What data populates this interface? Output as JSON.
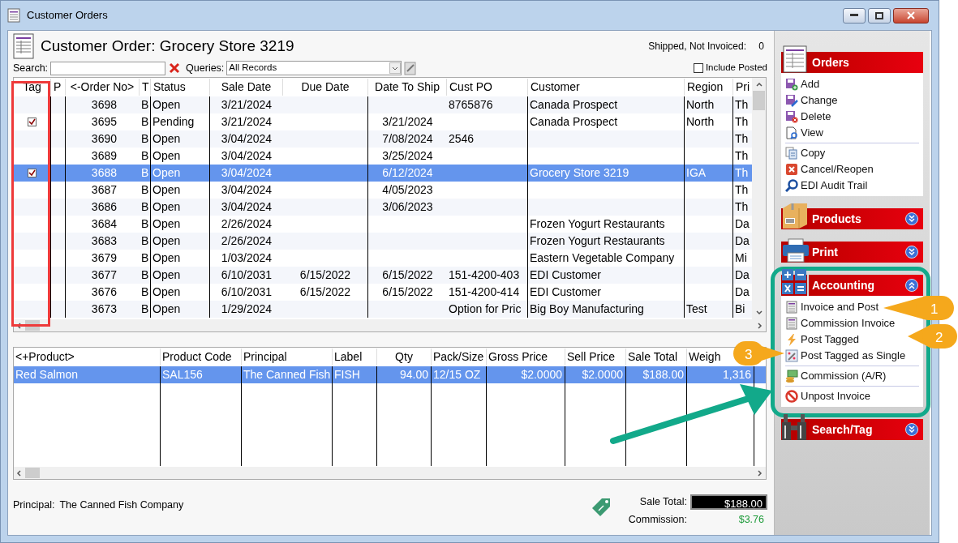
{
  "window": {
    "title": "Customer Orders"
  },
  "header": {
    "title": "Customer Order: Grocery Store 3219",
    "shipped_label": "Shipped, Not Invoiced:",
    "shipped_value": "0"
  },
  "search": {
    "label": "Search:",
    "queries_label": "Queries:",
    "query": "All Records",
    "include_posted": {
      "label": "Include Posted",
      "checked": false
    }
  },
  "orders": {
    "columns": [
      "Tag",
      "P",
      "<-Order No>",
      "T",
      "Status",
      "Sale Date",
      "Due Date",
      "Date To Ship",
      "Cust PO",
      "Customer",
      "Region",
      "Pri"
    ],
    "rows": [
      {
        "tagged": false,
        "selected": false,
        "cells": [
          "",
          "",
          "3698",
          "B",
          "Open",
          "3/21/2024",
          "",
          "",
          "8765876",
          "Canada Prospect",
          "North",
          "Th"
        ]
      },
      {
        "tagged": true,
        "selected": false,
        "cells": [
          "",
          "",
          "3695",
          "B",
          "Pending",
          "3/21/2024",
          "",
          "3/21/2024",
          "",
          "Canada Prospect",
          "North",
          "Th"
        ]
      },
      {
        "tagged": false,
        "selected": false,
        "cells": [
          "",
          "",
          "3690",
          "B",
          "Open",
          "3/04/2024",
          "",
          "7/08/2024",
          "2546",
          "",
          "",
          "Th"
        ]
      },
      {
        "tagged": false,
        "selected": false,
        "cells": [
          "",
          "",
          "3689",
          "B",
          "Open",
          "3/04/2024",
          "",
          "3/25/2024",
          "",
          "",
          "",
          "Th"
        ]
      },
      {
        "tagged": true,
        "selected": true,
        "cells": [
          "",
          "",
          "3688",
          "B",
          "Open",
          "3/04/2024",
          "",
          "6/12/2024",
          "",
          "Grocery Store 3219",
          "IGA",
          "Th"
        ]
      },
      {
        "tagged": false,
        "selected": false,
        "cells": [
          "",
          "",
          "3687",
          "B",
          "Open",
          "3/04/2024",
          "",
          "4/05/2023",
          "",
          "",
          "",
          "Th"
        ]
      },
      {
        "tagged": false,
        "selected": false,
        "cells": [
          "",
          "",
          "3686",
          "B",
          "Open",
          "3/04/2024",
          "",
          "3/06/2023",
          "",
          "",
          "",
          "Th"
        ]
      },
      {
        "tagged": false,
        "selected": false,
        "cells": [
          "",
          "",
          "3684",
          "B",
          "Open",
          "2/26/2024",
          "",
          "",
          "",
          "Frozen Yogurt Restaurants",
          "",
          "Da"
        ]
      },
      {
        "tagged": false,
        "selected": false,
        "cells": [
          "",
          "",
          "3683",
          "B",
          "Open",
          "2/26/2024",
          "",
          "",
          "",
          "Frozen Yogurt Restaurants",
          "",
          "Da"
        ]
      },
      {
        "tagged": false,
        "selected": false,
        "cells": [
          "",
          "",
          "3679",
          "B",
          "Open",
          "1/03/2024",
          "",
          "",
          "",
          "Eastern Vegetable Company",
          "",
          "Mi"
        ]
      },
      {
        "tagged": false,
        "selected": false,
        "cells": [
          "",
          "",
          "3677",
          "B",
          "Open",
          "6/10/2031",
          "6/15/2022",
          "6/15/2022",
          "151-4200-403",
          "EDI Customer",
          "",
          "Da"
        ]
      },
      {
        "tagged": false,
        "selected": false,
        "cells": [
          "",
          "",
          "3676",
          "B",
          "Open",
          "6/10/2031",
          "6/15/2022",
          "6/15/2022",
          "151-4200-414",
          "EDI Customer",
          "",
          "Da"
        ]
      },
      {
        "tagged": false,
        "selected": false,
        "cells": [
          "",
          "",
          "3673",
          "B",
          "Open",
          "1/29/2024",
          "",
          "",
          "Option for Pric",
          "Big Boy Manufacturing",
          "Test",
          "Bi"
        ]
      }
    ]
  },
  "products": {
    "columns": [
      "<+Product>",
      "Product Code",
      "Principal",
      "Label",
      "Qty",
      "Pack/Size",
      "Gross Price",
      "Sell Price",
      "Sale Total",
      "Weigh"
    ],
    "rows": [
      {
        "selected": true,
        "cells": [
          "Red Salmon",
          "SAL156",
          "The Canned Fish",
          "FISH",
          "94.00",
          "12/15 OZ",
          "$2.0000",
          "$2.0000",
          "$188.00",
          "1,316"
        ]
      }
    ]
  },
  "footer": {
    "principal_label": "Principal:",
    "principal": "The Canned Fish Company",
    "sale_total_label": "Sale Total:",
    "sale_total": "$188.00",
    "commission_label": "Commission:",
    "commission": "$3.76"
  },
  "sidebar": {
    "sections": [
      {
        "title": "Orders",
        "kind": "document",
        "toggle_button": false,
        "expanded": true,
        "groups": [
          [
            {
              "label": "Add",
              "kind": "add"
            },
            {
              "label": "Change",
              "kind": "change"
            },
            {
              "label": "Delete",
              "kind": "delete"
            },
            {
              "label": "View",
              "kind": "view"
            }
          ],
          [
            {
              "label": "Copy",
              "kind": "copy"
            },
            {
              "label": "Cancel/Reopen",
              "kind": "cancel"
            },
            {
              "label": "EDI Audit Trail",
              "kind": "search"
            }
          ]
        ]
      },
      {
        "title": "Products",
        "kind": "box",
        "toggle_button": true,
        "expanded": false
      },
      {
        "title": "Print",
        "kind": "printer",
        "toggle_button": true,
        "expanded": false
      },
      {
        "title": "Accounting",
        "kind": "calculator",
        "toggle_button": true,
        "expanded": true,
        "groups": [
          [
            {
              "label": "Invoice and Post",
              "kind": "document"
            },
            {
              "label": "Commission Invoice",
              "kind": "document"
            },
            {
              "label": "Post Tagged",
              "kind": "bolt"
            },
            {
              "label": "Post Tagged as Single",
              "kind": "wand"
            }
          ],
          [
            {
              "label": "Commission (A/R)",
              "kind": "money"
            }
          ],
          [
            {
              "label": "Unpost Invoice",
              "kind": "forbidden"
            }
          ]
        ]
      },
      {
        "title": "Search/Tag",
        "kind": "binoculars",
        "toggle_button": true,
        "expanded": false
      }
    ]
  },
  "callouts": [
    {
      "label": "1"
    },
    {
      "label": "2"
    },
    {
      "label": "3"
    }
  ]
}
